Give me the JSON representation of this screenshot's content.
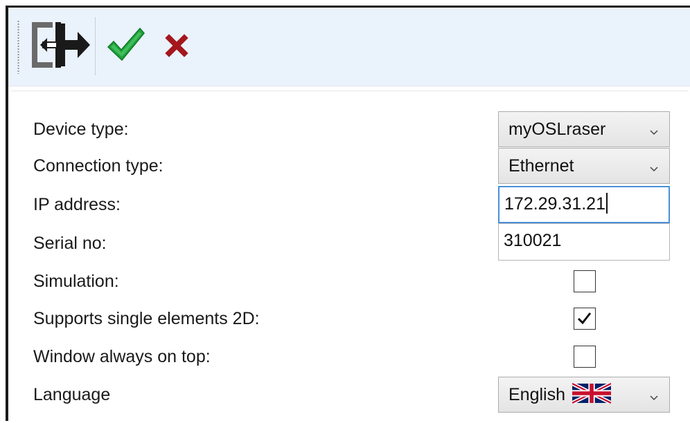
{
  "toolbar": {
    "exit_icon": "exit-door-arrow-icon",
    "ok_icon": "green-checkmark-icon",
    "cancel_icon": "red-x-icon",
    "ok_color": "#1fa23a",
    "cancel_color": "#a3171d"
  },
  "settings": {
    "device_type": {
      "label": "Device type:",
      "value": "myOSLraser"
    },
    "connection_type": {
      "label": "Connection type:",
      "value": "Ethernet"
    },
    "ip_address": {
      "label": "IP address:",
      "value": "172.29.31.21"
    },
    "serial_no": {
      "label": "Serial no:",
      "value": "310021"
    },
    "simulation": {
      "label": "Simulation:",
      "checked": false
    },
    "supports_single_elements_2d": {
      "label": "Supports single elements 2D:",
      "checked": true
    },
    "window_always_on_top": {
      "label": "Window always on top:",
      "checked": false
    },
    "language": {
      "label": "Language",
      "value": "English",
      "flag_icon": "uk-flag-icon"
    }
  },
  "accent_color": "#4a90d9"
}
